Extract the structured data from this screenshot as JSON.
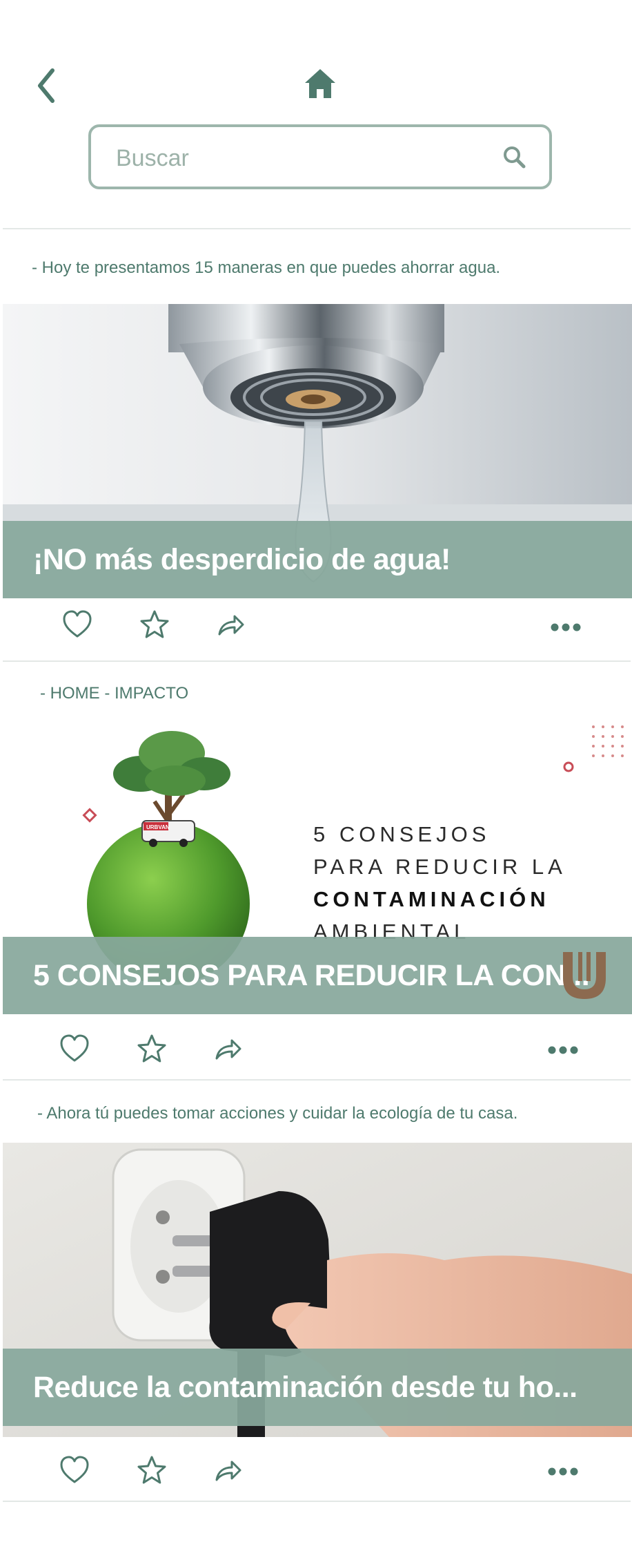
{
  "header": {
    "back_icon": "chevron-left-icon",
    "home_icon": "home-icon",
    "search_placeholder": "Buscar",
    "search_icon": "search-icon"
  },
  "posts": [
    {
      "caption": "- Hoy te presentamos 15 maneras en que puedes ahorrar agua.",
      "title": "¡NO más desperdicio de agua!"
    },
    {
      "caption": "- HOME - IMPACTO",
      "title": "5 CONSEJOS PARA REDUCIR LA CON...",
      "poster": {
        "line1": "5 CONSEJOS",
        "line2": "PARA REDUCIR LA",
        "line3": "CONTAMINACIÓN",
        "line4": "AMBIENTAL",
        "van_label": "URBVAN"
      }
    },
    {
      "caption": "- Ahora tú puedes tomar acciones y cuidar la ecología de tu casa.",
      "title": "Reduce la contaminación desde tu ho..."
    }
  ],
  "actions": {
    "like_icon": "heart-icon",
    "favorite_icon": "star-icon",
    "share_icon": "share-icon",
    "more_icon": "more-icon"
  },
  "colors": {
    "accent": "#4e7a6d",
    "overlay": "#88a89c",
    "border": "#9db6ac"
  }
}
